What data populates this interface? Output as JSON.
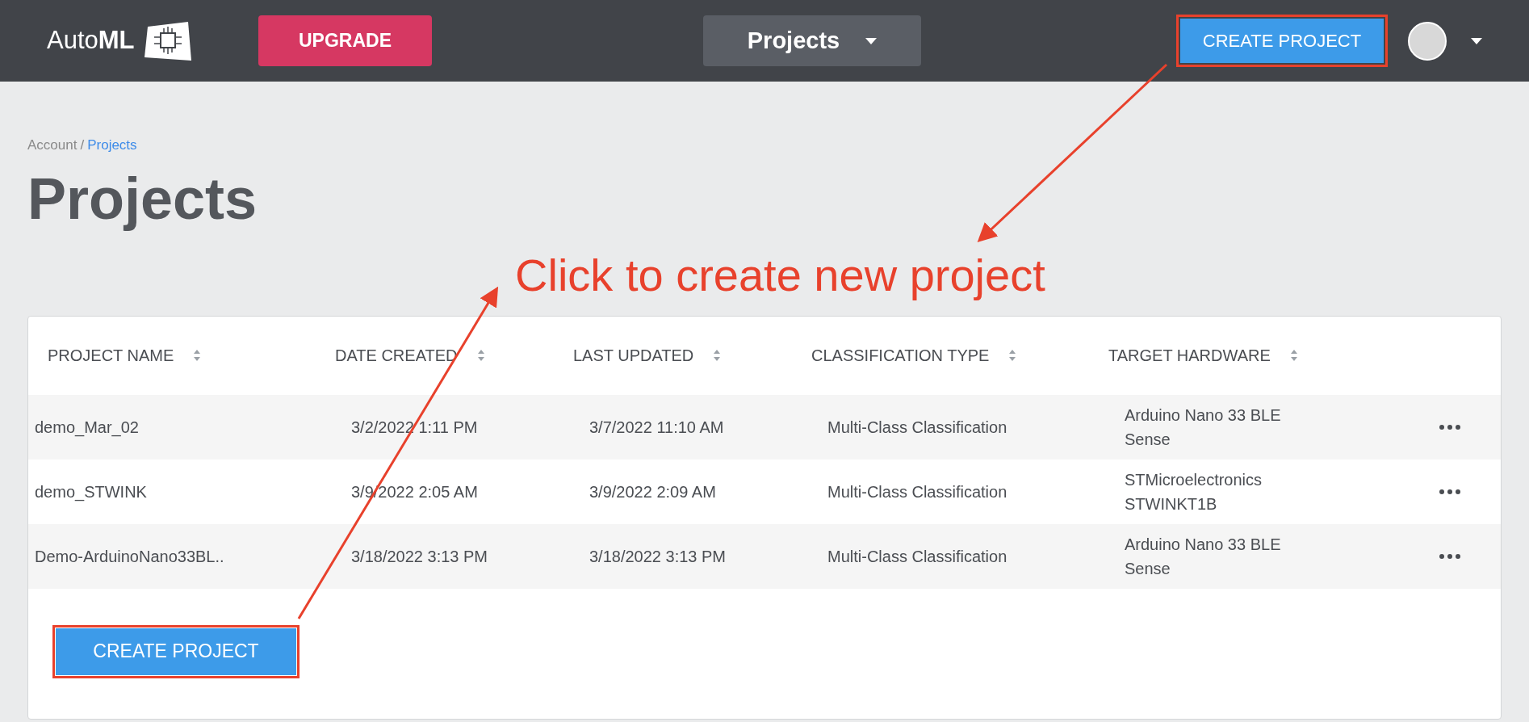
{
  "header": {
    "logo": {
      "text": "Auto",
      "bold": "ML"
    },
    "upgrade_button": "UPGRADE",
    "project_menu": "Projects",
    "create_button": "CREATE PROJECT"
  },
  "breadcrumb": [
    {
      "label": "Account",
      "selected": false
    },
    {
      "label": "Projects",
      "selected": true
    }
  ],
  "breadcrumb_separator": "/",
  "page_title": "Projects",
  "annotation": {
    "text": "Click to create new project"
  },
  "table": {
    "columns": [
      "PROJECT NAME",
      "DATE CREATED",
      "LAST UPDATED",
      "CLASSIFICATION TYPE",
      "TARGET HARDWARE"
    ],
    "rows": [
      {
        "cells": [
          "demo_Mar_02",
          "3/2/2022 1:11 PM",
          "3/7/2022 11:10 AM",
          "Multi-Class Classification",
          "Arduino Nano 33 BLE Sense"
        ]
      },
      {
        "cells": [
          "demo_STWINK",
          "3/9/2022 2:05 AM",
          "3/9/2022 2:09 AM",
          "Multi-Class Classification",
          "STMicroelectronics STWINKT1B"
        ]
      },
      {
        "cells": [
          "Demo-ArduinoNano33BL..",
          "3/18/2022 3:13 PM",
          "3/18/2022 3:13 PM",
          "Multi-Class Classification",
          "Arduino Nano 33 BLE Sense"
        ]
      }
    ]
  },
  "create_button": "CREATE PROJECT"
}
